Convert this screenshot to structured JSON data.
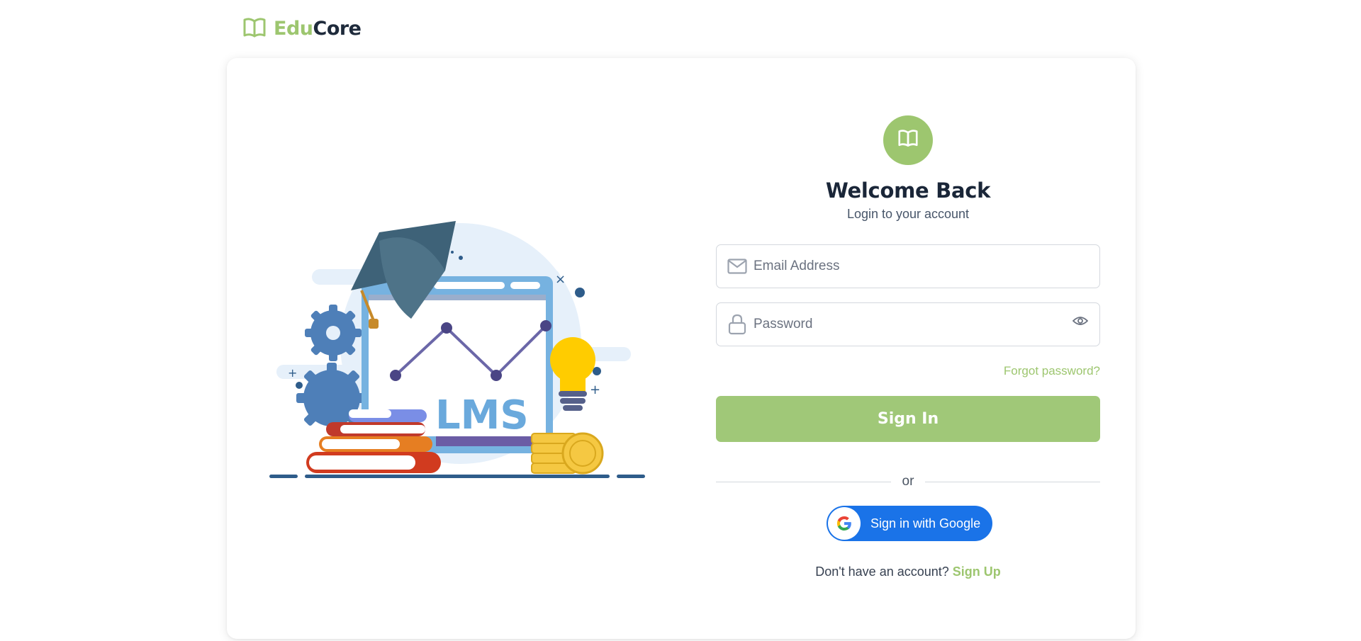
{
  "brand": {
    "name_part1": "Edu",
    "name_part2": "Core",
    "logo_icon": "open-book-icon",
    "accent": "#9dc66f",
    "dark": "#1e2a3b"
  },
  "illustration": {
    "label": "LMS"
  },
  "login": {
    "avatar_icon": "open-book-icon",
    "title": "Welcome Back",
    "subtitle": "Login to your account",
    "email_placeholder": "Email Address",
    "email_icon": "envelope-icon",
    "password_placeholder": "Password",
    "password_icon": "lock-icon",
    "password_toggle_icon": "eye-icon",
    "forgot_label": "Forgot password?",
    "signin_label": "Sign In",
    "divider_label": "or",
    "google_label": "Sign in with Google",
    "signup_prompt": "Don't have an account?",
    "signup_link": "Sign Up"
  }
}
